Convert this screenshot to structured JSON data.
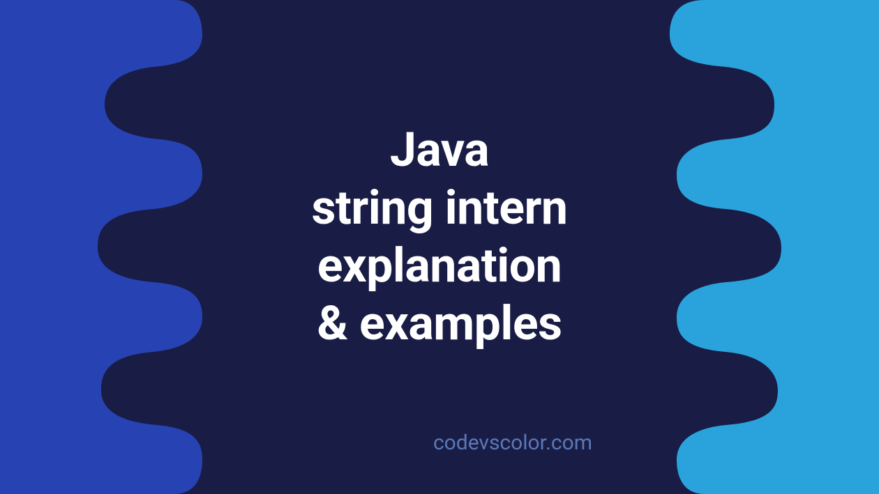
{
  "title": {
    "line1": "Java",
    "line2": "string intern",
    "line3": "explanation",
    "line4": "& examples"
  },
  "watermark": "codevscolor.com",
  "colors": {
    "bg_center": "#191d45",
    "bg_left": "#2742b3",
    "bg_right": "#2aa3dd",
    "text_main": "#ffffff",
    "text_watermark": "#5b78b8"
  }
}
